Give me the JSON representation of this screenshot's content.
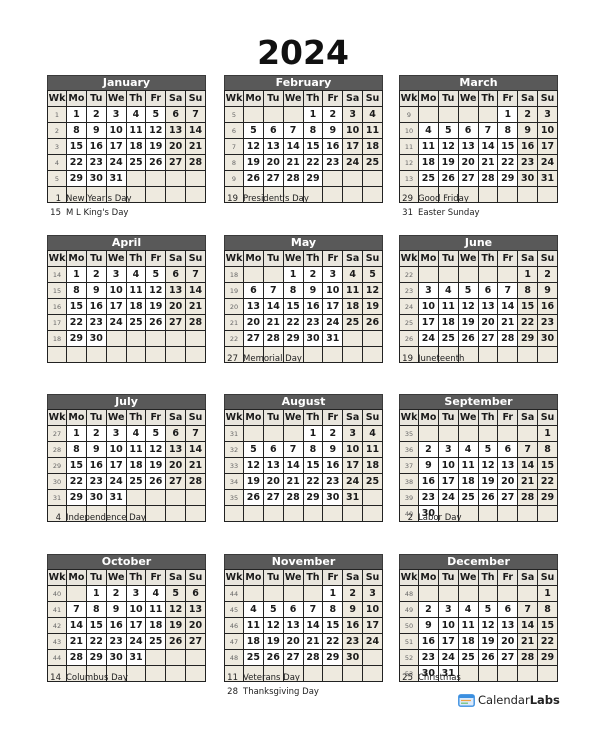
{
  "title": "2024",
  "weekday_headers": [
    "Wk",
    "Mo",
    "Tu",
    "We",
    "Th",
    "Fr",
    "Sa",
    "Su"
  ],
  "months": [
    {
      "name": "January",
      "weeks": [
        {
          "wk": "1",
          "days": [
            "1",
            "2",
            "3",
            "4",
            "5",
            "6",
            "7"
          ]
        },
        {
          "wk": "2",
          "days": [
            "8",
            "9",
            "10",
            "11",
            "12",
            "13",
            "14"
          ]
        },
        {
          "wk": "3",
          "days": [
            "15",
            "16",
            "17",
            "18",
            "19",
            "20",
            "21"
          ]
        },
        {
          "wk": "4",
          "days": [
            "22",
            "23",
            "24",
            "25",
            "26",
            "27",
            "28"
          ]
        },
        {
          "wk": "5",
          "days": [
            "29",
            "30",
            "31",
            "",
            "",
            "",
            ""
          ]
        },
        {
          "wk": "",
          "days": [
            "",
            "",
            "",
            "",
            "",
            "",
            ""
          ]
        }
      ],
      "holidays": [
        {
          "day": "1",
          "name": "New Year's Day"
        },
        {
          "day": "15",
          "name": "M L King's Day"
        }
      ]
    },
    {
      "name": "February",
      "weeks": [
        {
          "wk": "5",
          "days": [
            "",
            "",
            "",
            "1",
            "2",
            "3",
            "4"
          ]
        },
        {
          "wk": "6",
          "days": [
            "5",
            "6",
            "7",
            "8",
            "9",
            "10",
            "11"
          ]
        },
        {
          "wk": "7",
          "days": [
            "12",
            "13",
            "14",
            "15",
            "16",
            "17",
            "18"
          ]
        },
        {
          "wk": "8",
          "days": [
            "19",
            "20",
            "21",
            "22",
            "23",
            "24",
            "25"
          ]
        },
        {
          "wk": "9",
          "days": [
            "26",
            "27",
            "28",
            "29",
            "",
            "",
            ""
          ]
        },
        {
          "wk": "",
          "days": [
            "",
            "",
            "",
            "",
            "",
            "",
            ""
          ]
        }
      ],
      "holidays": [
        {
          "day": "19",
          "name": "President's Day"
        }
      ]
    },
    {
      "name": "March",
      "weeks": [
        {
          "wk": "9",
          "days": [
            "",
            "",
            "",
            "",
            "1",
            "2",
            "3"
          ]
        },
        {
          "wk": "10",
          "days": [
            "4",
            "5",
            "6",
            "7",
            "8",
            "9",
            "10"
          ]
        },
        {
          "wk": "11",
          "days": [
            "11",
            "12",
            "13",
            "14",
            "15",
            "16",
            "17"
          ]
        },
        {
          "wk": "12",
          "days": [
            "18",
            "19",
            "20",
            "21",
            "22",
            "23",
            "24"
          ]
        },
        {
          "wk": "13",
          "days": [
            "25",
            "26",
            "27",
            "28",
            "29",
            "30",
            "31"
          ]
        },
        {
          "wk": "",
          "days": [
            "",
            "",
            "",
            "",
            "",
            "",
            ""
          ]
        }
      ],
      "holidays": [
        {
          "day": "29",
          "name": "Good Friday"
        },
        {
          "day": "31",
          "name": "Easter Sunday"
        }
      ]
    },
    {
      "name": "April",
      "weeks": [
        {
          "wk": "14",
          "days": [
            "1",
            "2",
            "3",
            "4",
            "5",
            "6",
            "7"
          ]
        },
        {
          "wk": "15",
          "days": [
            "8",
            "9",
            "10",
            "11",
            "12",
            "13",
            "14"
          ]
        },
        {
          "wk": "16",
          "days": [
            "15",
            "16",
            "17",
            "18",
            "19",
            "20",
            "21"
          ]
        },
        {
          "wk": "17",
          "days": [
            "22",
            "23",
            "24",
            "25",
            "26",
            "27",
            "28"
          ]
        },
        {
          "wk": "18",
          "days": [
            "29",
            "30",
            "",
            "",
            "",
            "",
            ""
          ]
        },
        {
          "wk": "",
          "days": [
            "",
            "",
            "",
            "",
            "",
            "",
            ""
          ]
        }
      ],
      "holidays": []
    },
    {
      "name": "May",
      "weeks": [
        {
          "wk": "18",
          "days": [
            "",
            "",
            "1",
            "2",
            "3",
            "4",
            "5"
          ]
        },
        {
          "wk": "19",
          "days": [
            "6",
            "7",
            "8",
            "9",
            "10",
            "11",
            "12"
          ]
        },
        {
          "wk": "20",
          "days": [
            "13",
            "14",
            "15",
            "16",
            "17",
            "18",
            "19"
          ]
        },
        {
          "wk": "21",
          "days": [
            "20",
            "21",
            "22",
            "23",
            "24",
            "25",
            "26"
          ]
        },
        {
          "wk": "22",
          "days": [
            "27",
            "28",
            "29",
            "30",
            "31",
            "",
            ""
          ]
        },
        {
          "wk": "",
          "days": [
            "",
            "",
            "",
            "",
            "",
            "",
            ""
          ]
        }
      ],
      "holidays": [
        {
          "day": "27",
          "name": "Memorial Day"
        }
      ]
    },
    {
      "name": "June",
      "weeks": [
        {
          "wk": "22",
          "days": [
            "",
            "",
            "",
            "",
            "",
            "1",
            "2"
          ]
        },
        {
          "wk": "23",
          "days": [
            "3",
            "4",
            "5",
            "6",
            "7",
            "8",
            "9"
          ]
        },
        {
          "wk": "24",
          "days": [
            "10",
            "11",
            "12",
            "13",
            "14",
            "15",
            "16"
          ]
        },
        {
          "wk": "25",
          "days": [
            "17",
            "18",
            "19",
            "20",
            "21",
            "22",
            "23"
          ]
        },
        {
          "wk": "26",
          "days": [
            "24",
            "25",
            "26",
            "27",
            "28",
            "29",
            "30"
          ]
        },
        {
          "wk": "",
          "days": [
            "",
            "",
            "",
            "",
            "",
            "",
            ""
          ]
        }
      ],
      "holidays": [
        {
          "day": "19",
          "name": "Juneteenth"
        }
      ]
    },
    {
      "name": "July",
      "weeks": [
        {
          "wk": "27",
          "days": [
            "1",
            "2",
            "3",
            "4",
            "5",
            "6",
            "7"
          ]
        },
        {
          "wk": "28",
          "days": [
            "8",
            "9",
            "10",
            "11",
            "12",
            "13",
            "14"
          ]
        },
        {
          "wk": "29",
          "days": [
            "15",
            "16",
            "17",
            "18",
            "19",
            "20",
            "21"
          ]
        },
        {
          "wk": "30",
          "days": [
            "22",
            "23",
            "24",
            "25",
            "26",
            "27",
            "28"
          ]
        },
        {
          "wk": "31",
          "days": [
            "29",
            "30",
            "31",
            "",
            "",
            "",
            ""
          ]
        },
        {
          "wk": "",
          "days": [
            "",
            "",
            "",
            "",
            "",
            "",
            ""
          ]
        }
      ],
      "holidays": [
        {
          "day": "4",
          "name": "Independence Day"
        }
      ]
    },
    {
      "name": "August",
      "weeks": [
        {
          "wk": "31",
          "days": [
            "",
            "",
            "",
            "1",
            "2",
            "3",
            "4"
          ]
        },
        {
          "wk": "32",
          "days": [
            "5",
            "6",
            "7",
            "8",
            "9",
            "10",
            "11"
          ]
        },
        {
          "wk": "33",
          "days": [
            "12",
            "13",
            "14",
            "15",
            "16",
            "17",
            "18"
          ]
        },
        {
          "wk": "34",
          "days": [
            "19",
            "20",
            "21",
            "22",
            "23",
            "24",
            "25"
          ]
        },
        {
          "wk": "35",
          "days": [
            "26",
            "27",
            "28",
            "29",
            "30",
            "31",
            ""
          ]
        },
        {
          "wk": "",
          "days": [
            "",
            "",
            "",
            "",
            "",
            "",
            ""
          ]
        }
      ],
      "holidays": []
    },
    {
      "name": "September",
      "weeks": [
        {
          "wk": "35",
          "days": [
            "",
            "",
            "",
            "",
            "",
            "",
            "1"
          ]
        },
        {
          "wk": "36",
          "days": [
            "2",
            "3",
            "4",
            "5",
            "6",
            "7",
            "8"
          ]
        },
        {
          "wk": "37",
          "days": [
            "9",
            "10",
            "11",
            "12",
            "13",
            "14",
            "15"
          ]
        },
        {
          "wk": "38",
          "days": [
            "16",
            "17",
            "18",
            "19",
            "20",
            "21",
            "22"
          ]
        },
        {
          "wk": "39",
          "days": [
            "23",
            "24",
            "25",
            "26",
            "27",
            "28",
            "29"
          ]
        },
        {
          "wk": "40",
          "days": [
            "30",
            "",
            "",
            "",
            "",
            "",
            ""
          ]
        }
      ],
      "holidays": [
        {
          "day": "2",
          "name": "Labor Day"
        }
      ]
    },
    {
      "name": "October",
      "weeks": [
        {
          "wk": "40",
          "days": [
            "",
            "1",
            "2",
            "3",
            "4",
            "5",
            "6"
          ]
        },
        {
          "wk": "41",
          "days": [
            "7",
            "8",
            "9",
            "10",
            "11",
            "12",
            "13"
          ]
        },
        {
          "wk": "42",
          "days": [
            "14",
            "15",
            "16",
            "17",
            "18",
            "19",
            "20"
          ]
        },
        {
          "wk": "43",
          "days": [
            "21",
            "22",
            "23",
            "24",
            "25",
            "26",
            "27"
          ]
        },
        {
          "wk": "44",
          "days": [
            "28",
            "29",
            "30",
            "31",
            "",
            "",
            ""
          ]
        },
        {
          "wk": "",
          "days": [
            "",
            "",
            "",
            "",
            "",
            "",
            ""
          ]
        }
      ],
      "holidays": [
        {
          "day": "14",
          "name": "Columbus Day"
        }
      ]
    },
    {
      "name": "November",
      "weeks": [
        {
          "wk": "44",
          "days": [
            "",
            "",
            "",
            "",
            "1",
            "2",
            "3"
          ]
        },
        {
          "wk": "45",
          "days": [
            "4",
            "5",
            "6",
            "7",
            "8",
            "9",
            "10"
          ]
        },
        {
          "wk": "46",
          "days": [
            "11",
            "12",
            "13",
            "14",
            "15",
            "16",
            "17"
          ]
        },
        {
          "wk": "47",
          "days": [
            "18",
            "19",
            "20",
            "21",
            "22",
            "23",
            "24"
          ]
        },
        {
          "wk": "48",
          "days": [
            "25",
            "26",
            "27",
            "28",
            "29",
            "30",
            ""
          ]
        },
        {
          "wk": "",
          "days": [
            "",
            "",
            "",
            "",
            "",
            "",
            ""
          ]
        }
      ],
      "holidays": [
        {
          "day": "11",
          "name": "Veterans Day"
        },
        {
          "day": "28",
          "name": "Thanksgiving Day"
        }
      ]
    },
    {
      "name": "December",
      "weeks": [
        {
          "wk": "48",
          "days": [
            "",
            "",
            "",
            "",
            "",
            "",
            "1"
          ]
        },
        {
          "wk": "49",
          "days": [
            "2",
            "3",
            "4",
            "5",
            "6",
            "7",
            "8"
          ]
        },
        {
          "wk": "50",
          "days": [
            "9",
            "10",
            "11",
            "12",
            "13",
            "14",
            "15"
          ]
        },
        {
          "wk": "51",
          "days": [
            "16",
            "17",
            "18",
            "19",
            "20",
            "21",
            "22"
          ]
        },
        {
          "wk": "52",
          "days": [
            "23",
            "24",
            "25",
            "26",
            "27",
            "28",
            "29"
          ]
        },
        {
          "wk": "53",
          "days": [
            "30",
            "31",
            "",
            "",
            "",
            "",
            ""
          ]
        }
      ],
      "holidays": [
        {
          "day": "25",
          "name": "Christmas"
        }
      ]
    }
  ],
  "logo": {
    "part1": "Calendar",
    "part2": "Labs",
    "icon": "calendar-icon"
  },
  "colors": {
    "month_header_bg": "#595959",
    "weekend_bg": "#eeeadf",
    "weekday_bg": "#ffffff",
    "accent_logo": "#3b8fe0"
  }
}
